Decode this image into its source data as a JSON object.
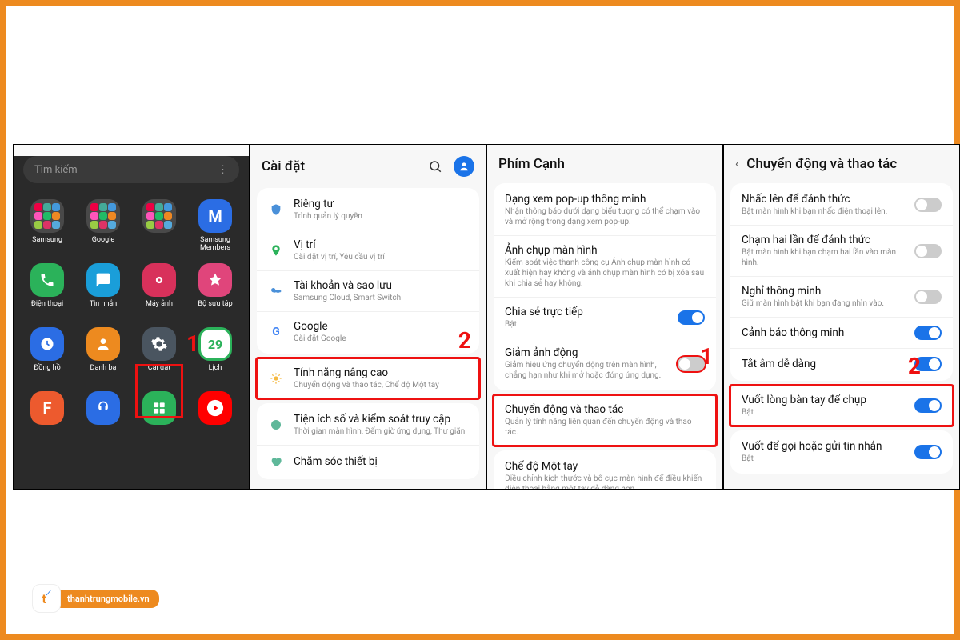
{
  "watermark": "thanhtrungmobile.vn",
  "panel1": {
    "search_placeholder": "Tìm kiếm",
    "apps": [
      {
        "label": "Samsung",
        "type": "folder"
      },
      {
        "label": "Google",
        "type": "folder"
      },
      {
        "label": "",
        "type": "folder"
      },
      {
        "label": "Samsung Members",
        "color": "#2b6de4",
        "glyph": "M"
      },
      {
        "label": "Điện thoại",
        "color": "#2bb25a",
        "glyph": "phone"
      },
      {
        "label": "Tin nhắn",
        "color": "#1a9ed9",
        "glyph": "chat"
      },
      {
        "label": "Máy ảnh",
        "color": "#d8315b",
        "glyph": "cam"
      },
      {
        "label": "Bộ sưu tập",
        "color": "#e0457b",
        "glyph": "gallery"
      },
      {
        "label": "Đồng hồ",
        "color": "#2b6de4",
        "glyph": "clock"
      },
      {
        "label": "Danh bạ",
        "color": "#ed8a1f",
        "glyph": "person"
      },
      {
        "label": "Cài đặt",
        "color": "#4a5560",
        "glyph": "gear"
      },
      {
        "label": "Lịch",
        "color": "#2bb25a",
        "glyph": "29"
      },
      {
        "label": "",
        "color": "#ed5a2e",
        "glyph": "F"
      },
      {
        "label": "",
        "color": "#2b6de4",
        "glyph": "head"
      },
      {
        "label": "",
        "color": "#2bb25a",
        "glyph": "calc"
      },
      {
        "label": "",
        "color": "#ff0000",
        "glyph": "yt"
      }
    ],
    "badge": "1"
  },
  "panel2": {
    "title": "Cài đặt",
    "rows": [
      {
        "icon": "shield",
        "color": "#4a90d9",
        "title": "Riêng tư",
        "sub": "Trình quản lý quyền"
      },
      {
        "icon": "pin",
        "color": "#2bb25a",
        "title": "Vị trí",
        "sub": "Cài đặt vị trí, Yêu cầu vị trí"
      },
      {
        "icon": "key",
        "color": "#4a90d9",
        "title": "Tài khoản và sao lưu",
        "sub": "Samsung Cloud, Smart Switch"
      },
      {
        "icon": "G",
        "color": "#4285f4",
        "title": "Google",
        "sub": "Cài đặt Google"
      },
      {
        "icon": "star",
        "color": "#f5b942",
        "title": "Tính năng nâng cao",
        "sub": "Chuyển động và thao tác, Chế độ Một tay",
        "hl": true
      },
      {
        "icon": "wellbeing",
        "color": "#5fb89a",
        "title": "Tiện ích số và kiểm soát truy cập",
        "sub": "Thời gian màn hình, Đếm giờ ứng dụng, Thư giãn"
      },
      {
        "icon": "care",
        "color": "#5fb89a",
        "title": "Chăm sóc thiết bị",
        "sub": ""
      }
    ],
    "badge": "2"
  },
  "panel3": {
    "title": "Phím Cạnh",
    "rows": [
      {
        "title": "Dạng xem pop-up thông minh",
        "sub": "Nhận thông báo dưới dạng biểu tượng có thể chạm vào và mở rộng trong dạng xem pop-up."
      },
      {
        "title": "Ảnh chụp màn hình",
        "sub": "Kiểm soát việc thanh công cụ Ảnh chụp màn hình có xuất hiện hay không và ảnh chụp màn hình có bị xóa sau khi chia sẻ hay không."
      },
      {
        "title": "Chia sẻ trực tiếp",
        "sub": "Bật",
        "toggle": "on"
      },
      {
        "title": "Giảm ảnh động",
        "sub": "Giảm hiệu ứng chuyển động trên màn hình, chẳng hạn như khi mở hoặc đóng ứng dụng.",
        "toggle": "off-red"
      },
      {
        "title": "Chuyển động và thao tác",
        "sub": "Quản lý tính năng liên quan đến chuyển động và thao tác.",
        "hl": true
      },
      {
        "title": "Chế độ Một tay",
        "sub": "Điều chỉnh kích thước và bố cục màn hình để điều khiển điện thoại bằng một tay dễ dàng hơn."
      }
    ],
    "badge": "1"
  },
  "panel4": {
    "title": "Chuyển động và thao tác",
    "rows": [
      {
        "title": "Nhấc lên để đánh thức",
        "sub": "Bật màn hình khi bạn nhấc điện thoại lên.",
        "toggle": "off"
      },
      {
        "title": "Chạm hai lần để đánh thức",
        "sub": "Bật màn hình khi bạn chạm hai lần vào màn hình.",
        "toggle": "off"
      },
      {
        "title": "Nghỉ thông minh",
        "sub": "Giữ màn hình bật khi bạn đang nhìn vào.",
        "toggle": "off"
      },
      {
        "title": "Cảnh báo thông minh",
        "sub": "",
        "toggle": "on"
      },
      {
        "title": "Tắt âm dễ dàng",
        "sub": "",
        "toggle": "on"
      },
      {
        "title": "Vuốt lòng bàn tay để chụp",
        "sub": "Bật",
        "toggle": "on",
        "hl": true
      },
      {
        "title": "Vuốt để gọi hoặc gửi tin nhắn",
        "sub": "Bật",
        "toggle": "on"
      }
    ],
    "badge": "2"
  }
}
